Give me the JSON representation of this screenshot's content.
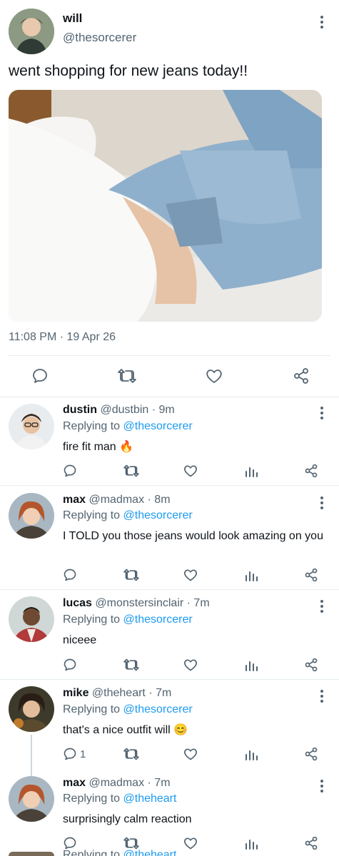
{
  "main_tweet": {
    "display_name": "will",
    "handle": "@thesorcerer",
    "text": "went shopping for new jeans today!!",
    "timestamp": "11:08 PM · 19 Apr 26"
  },
  "replies": [
    {
      "display_name": "dustin",
      "handle": "@dustbin",
      "time": "· 9m",
      "replying_prefix": "Replying to",
      "replying_to": "@thesorcerer",
      "text": "fire fit man",
      "emoji": "🔥",
      "reply_count": ""
    },
    {
      "display_name": "max",
      "handle": "@madmax",
      "time": "· 8m",
      "replying_prefix": "Replying to",
      "replying_to": "@thesorcerer",
      "text": "I TOLD you those jeans would look amazing on you",
      "reply_count": ""
    },
    {
      "display_name": "lucas",
      "handle": "@monstersinclair",
      "time": "· 7m",
      "replying_prefix": "Replying to",
      "replying_to": "@thesorcerer",
      "text": "niceee",
      "reply_count": ""
    },
    {
      "display_name": "mike",
      "handle": "@theheart",
      "time": "· 7m",
      "replying_prefix": "Replying to",
      "replying_to": "@thesorcerer",
      "text": "that's a nice outfit will",
      "emoji": "😊",
      "reply_count": "1"
    },
    {
      "display_name": "max",
      "handle": "@madmax",
      "time": "· 7m",
      "replying_prefix": "Replying to",
      "replying_to": "@theheart",
      "text": "surprisingly calm reaction",
      "reply_count": ""
    }
  ],
  "partial_next": {
    "replying_prefix": "Replying to",
    "replying_to": "@theheart"
  },
  "colors": {
    "accent": "#1d9bf0",
    "text": "#0f1419",
    "muted": "#536471",
    "divider": "#e6ecf0"
  },
  "icons": [
    "reply-icon",
    "retweet-icon",
    "like-icon",
    "share-icon",
    "views-icon",
    "more-icon"
  ]
}
